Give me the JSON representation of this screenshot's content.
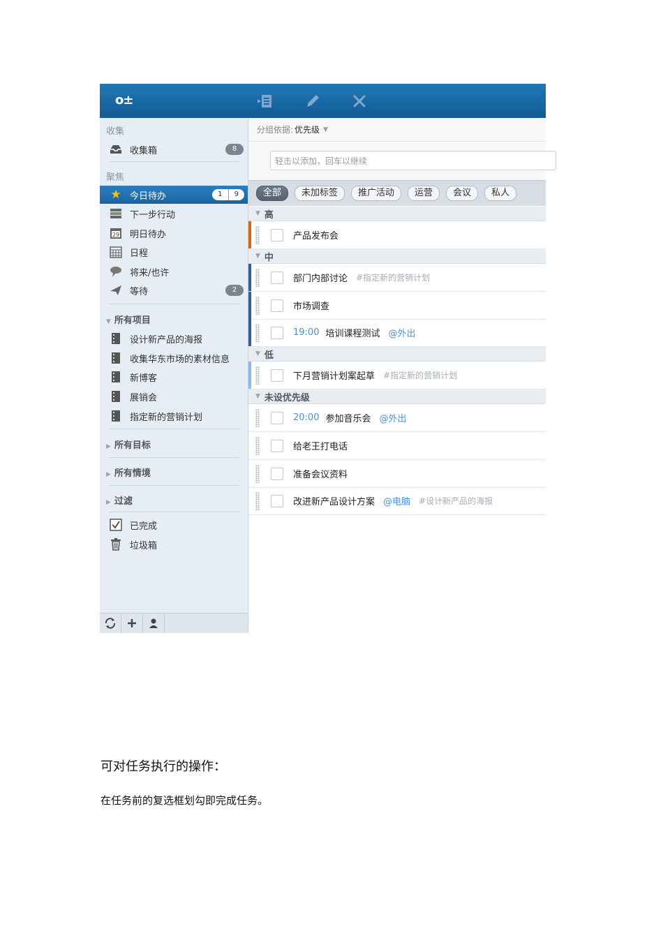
{
  "app": {
    "logo": "o±",
    "toolbar": {
      "move_icon": "move-to-icon",
      "edit_icon": "pencil-icon",
      "delete_icon": "close-icon"
    }
  },
  "sidebar": {
    "collect_header": "收集",
    "inbox": {
      "label": "收集箱",
      "count": "8",
      "icon": "inbox-icon"
    },
    "focus_header": "聚焦",
    "focus_items": [
      {
        "label": "今日待办",
        "icon": "star-icon",
        "badge_a": "1",
        "badge_b": "9"
      },
      {
        "label": "下一步行动",
        "icon": "next-action-icon"
      },
      {
        "label": "明日待办",
        "icon": "calendar-29-icon"
      },
      {
        "label": "日程",
        "icon": "calendar-grid-icon"
      },
      {
        "label": "将来/也许",
        "icon": "speech-bubble-icon"
      },
      {
        "label": "等待",
        "icon": "paper-plane-icon",
        "count": "2"
      }
    ],
    "projects_header": "所有项目",
    "projects": [
      {
        "label": "设计新产品的海报"
      },
      {
        "label": "收集华东市场的素材信息"
      },
      {
        "label": "新博客"
      },
      {
        "label": "展销会"
      },
      {
        "label": "指定新的营销计划"
      }
    ],
    "goals_header": "所有目标",
    "contexts_header": "所有情境",
    "filters_header": "过滤",
    "done": {
      "label": "已完成",
      "icon": "checkbox-icon"
    },
    "trash": {
      "label": "垃圾箱",
      "icon": "trash-icon"
    },
    "footer": {
      "sync_icon": "sync-icon",
      "add_icon": "plus-icon",
      "user_icon": "user-icon"
    }
  },
  "main": {
    "grouping_label": "分组依据:",
    "grouping_value": "优先级",
    "add_placeholder": "轻击以添加，回车以继续",
    "tags": [
      "全部",
      "未加标签",
      "推广活动",
      "运营",
      "会议",
      "私人"
    ],
    "groups": [
      {
        "label": "高",
        "color": "#d46a12",
        "tasks": [
          {
            "title": "产品发布会",
            "time": "",
            "context": "",
            "project": ""
          }
        ]
      },
      {
        "label": "中",
        "color": "#2f5da8",
        "tasks": [
          {
            "title": "部门内部讨论",
            "time": "",
            "context": "",
            "project": "#指定新的营销计划"
          },
          {
            "title": "市场调查",
            "time": "",
            "context": "",
            "project": ""
          },
          {
            "title": "培训课程测试",
            "time": "19:00",
            "context": "@外出",
            "project": ""
          }
        ]
      },
      {
        "label": "低",
        "color": "#8fb9ee",
        "tasks": [
          {
            "title": "下月营销计划案起草",
            "time": "",
            "context": "",
            "project": "#指定新的营销计划"
          }
        ]
      },
      {
        "label": "未设优先级",
        "color": "",
        "tasks": [
          {
            "title": "参加音乐会",
            "time": "20:00",
            "context": "@外出",
            "project": ""
          },
          {
            "title": "给老王打电话",
            "time": "",
            "context": "",
            "project": ""
          },
          {
            "title": "准备会议资料",
            "time": "",
            "context": "",
            "project": ""
          },
          {
            "title": "改进新产品设计方案",
            "time": "",
            "context": "@电脑",
            "project": "#设计新产品的海报"
          }
        ]
      }
    ]
  },
  "doc": {
    "heading": "可对任务执行的操作：",
    "paragraph": "在任务前的复选框划勾即完成任务。"
  }
}
